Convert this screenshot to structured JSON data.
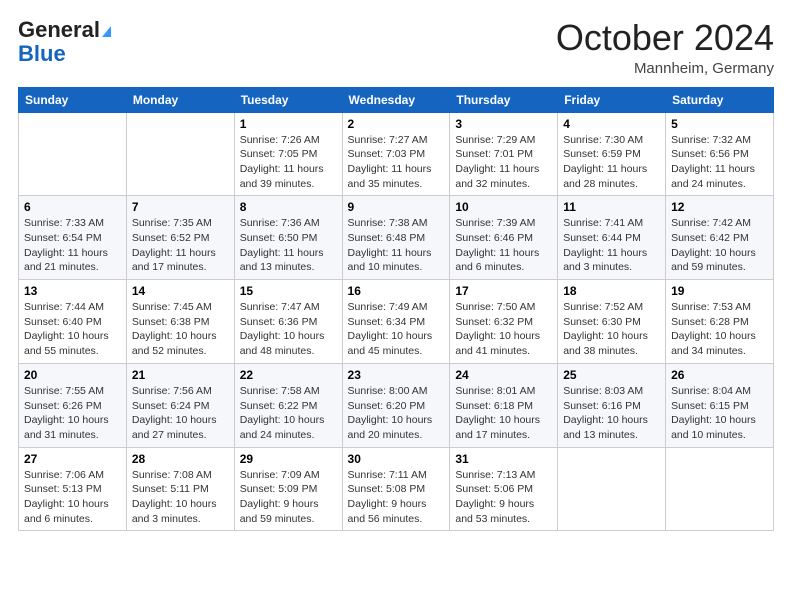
{
  "header": {
    "logo_line1": "General",
    "logo_line2": "Blue",
    "month": "October 2024",
    "location": "Mannheim, Germany"
  },
  "weekdays": [
    "Sunday",
    "Monday",
    "Tuesday",
    "Wednesday",
    "Thursday",
    "Friday",
    "Saturday"
  ],
  "weeks": [
    [
      {
        "day": "",
        "sunrise": "",
        "sunset": "",
        "daylight": ""
      },
      {
        "day": "",
        "sunrise": "",
        "sunset": "",
        "daylight": ""
      },
      {
        "day": "1",
        "sunrise": "Sunrise: 7:26 AM",
        "sunset": "Sunset: 7:05 PM",
        "daylight": "Daylight: 11 hours and 39 minutes."
      },
      {
        "day": "2",
        "sunrise": "Sunrise: 7:27 AM",
        "sunset": "Sunset: 7:03 PM",
        "daylight": "Daylight: 11 hours and 35 minutes."
      },
      {
        "day": "3",
        "sunrise": "Sunrise: 7:29 AM",
        "sunset": "Sunset: 7:01 PM",
        "daylight": "Daylight: 11 hours and 32 minutes."
      },
      {
        "day": "4",
        "sunrise": "Sunrise: 7:30 AM",
        "sunset": "Sunset: 6:59 PM",
        "daylight": "Daylight: 11 hours and 28 minutes."
      },
      {
        "day": "5",
        "sunrise": "Sunrise: 7:32 AM",
        "sunset": "Sunset: 6:56 PM",
        "daylight": "Daylight: 11 hours and 24 minutes."
      }
    ],
    [
      {
        "day": "6",
        "sunrise": "Sunrise: 7:33 AM",
        "sunset": "Sunset: 6:54 PM",
        "daylight": "Daylight: 11 hours and 21 minutes."
      },
      {
        "day": "7",
        "sunrise": "Sunrise: 7:35 AM",
        "sunset": "Sunset: 6:52 PM",
        "daylight": "Daylight: 11 hours and 17 minutes."
      },
      {
        "day": "8",
        "sunrise": "Sunrise: 7:36 AM",
        "sunset": "Sunset: 6:50 PM",
        "daylight": "Daylight: 11 hours and 13 minutes."
      },
      {
        "day": "9",
        "sunrise": "Sunrise: 7:38 AM",
        "sunset": "Sunset: 6:48 PM",
        "daylight": "Daylight: 11 hours and 10 minutes."
      },
      {
        "day": "10",
        "sunrise": "Sunrise: 7:39 AM",
        "sunset": "Sunset: 6:46 PM",
        "daylight": "Daylight: 11 hours and 6 minutes."
      },
      {
        "day": "11",
        "sunrise": "Sunrise: 7:41 AM",
        "sunset": "Sunset: 6:44 PM",
        "daylight": "Daylight: 11 hours and 3 minutes."
      },
      {
        "day": "12",
        "sunrise": "Sunrise: 7:42 AM",
        "sunset": "Sunset: 6:42 PM",
        "daylight": "Daylight: 10 hours and 59 minutes."
      }
    ],
    [
      {
        "day": "13",
        "sunrise": "Sunrise: 7:44 AM",
        "sunset": "Sunset: 6:40 PM",
        "daylight": "Daylight: 10 hours and 55 minutes."
      },
      {
        "day": "14",
        "sunrise": "Sunrise: 7:45 AM",
        "sunset": "Sunset: 6:38 PM",
        "daylight": "Daylight: 10 hours and 52 minutes."
      },
      {
        "day": "15",
        "sunrise": "Sunrise: 7:47 AM",
        "sunset": "Sunset: 6:36 PM",
        "daylight": "Daylight: 10 hours and 48 minutes."
      },
      {
        "day": "16",
        "sunrise": "Sunrise: 7:49 AM",
        "sunset": "Sunset: 6:34 PM",
        "daylight": "Daylight: 10 hours and 45 minutes."
      },
      {
        "day": "17",
        "sunrise": "Sunrise: 7:50 AM",
        "sunset": "Sunset: 6:32 PM",
        "daylight": "Daylight: 10 hours and 41 minutes."
      },
      {
        "day": "18",
        "sunrise": "Sunrise: 7:52 AM",
        "sunset": "Sunset: 6:30 PM",
        "daylight": "Daylight: 10 hours and 38 minutes."
      },
      {
        "day": "19",
        "sunrise": "Sunrise: 7:53 AM",
        "sunset": "Sunset: 6:28 PM",
        "daylight": "Daylight: 10 hours and 34 minutes."
      }
    ],
    [
      {
        "day": "20",
        "sunrise": "Sunrise: 7:55 AM",
        "sunset": "Sunset: 6:26 PM",
        "daylight": "Daylight: 10 hours and 31 minutes."
      },
      {
        "day": "21",
        "sunrise": "Sunrise: 7:56 AM",
        "sunset": "Sunset: 6:24 PM",
        "daylight": "Daylight: 10 hours and 27 minutes."
      },
      {
        "day": "22",
        "sunrise": "Sunrise: 7:58 AM",
        "sunset": "Sunset: 6:22 PM",
        "daylight": "Daylight: 10 hours and 24 minutes."
      },
      {
        "day": "23",
        "sunrise": "Sunrise: 8:00 AM",
        "sunset": "Sunset: 6:20 PM",
        "daylight": "Daylight: 10 hours and 20 minutes."
      },
      {
        "day": "24",
        "sunrise": "Sunrise: 8:01 AM",
        "sunset": "Sunset: 6:18 PM",
        "daylight": "Daylight: 10 hours and 17 minutes."
      },
      {
        "day": "25",
        "sunrise": "Sunrise: 8:03 AM",
        "sunset": "Sunset: 6:16 PM",
        "daylight": "Daylight: 10 hours and 13 minutes."
      },
      {
        "day": "26",
        "sunrise": "Sunrise: 8:04 AM",
        "sunset": "Sunset: 6:15 PM",
        "daylight": "Daylight: 10 hours and 10 minutes."
      }
    ],
    [
      {
        "day": "27",
        "sunrise": "Sunrise: 7:06 AM",
        "sunset": "Sunset: 5:13 PM",
        "daylight": "Daylight: 10 hours and 6 minutes."
      },
      {
        "day": "28",
        "sunrise": "Sunrise: 7:08 AM",
        "sunset": "Sunset: 5:11 PM",
        "daylight": "Daylight: 10 hours and 3 minutes."
      },
      {
        "day": "29",
        "sunrise": "Sunrise: 7:09 AM",
        "sunset": "Sunset: 5:09 PM",
        "daylight": "Daylight: 9 hours and 59 minutes."
      },
      {
        "day": "30",
        "sunrise": "Sunrise: 7:11 AM",
        "sunset": "Sunset: 5:08 PM",
        "daylight": "Daylight: 9 hours and 56 minutes."
      },
      {
        "day": "31",
        "sunrise": "Sunrise: 7:13 AM",
        "sunset": "Sunset: 5:06 PM",
        "daylight": "Daylight: 9 hours and 53 minutes."
      },
      {
        "day": "",
        "sunrise": "",
        "sunset": "",
        "daylight": ""
      },
      {
        "day": "",
        "sunrise": "",
        "sunset": "",
        "daylight": ""
      }
    ]
  ]
}
